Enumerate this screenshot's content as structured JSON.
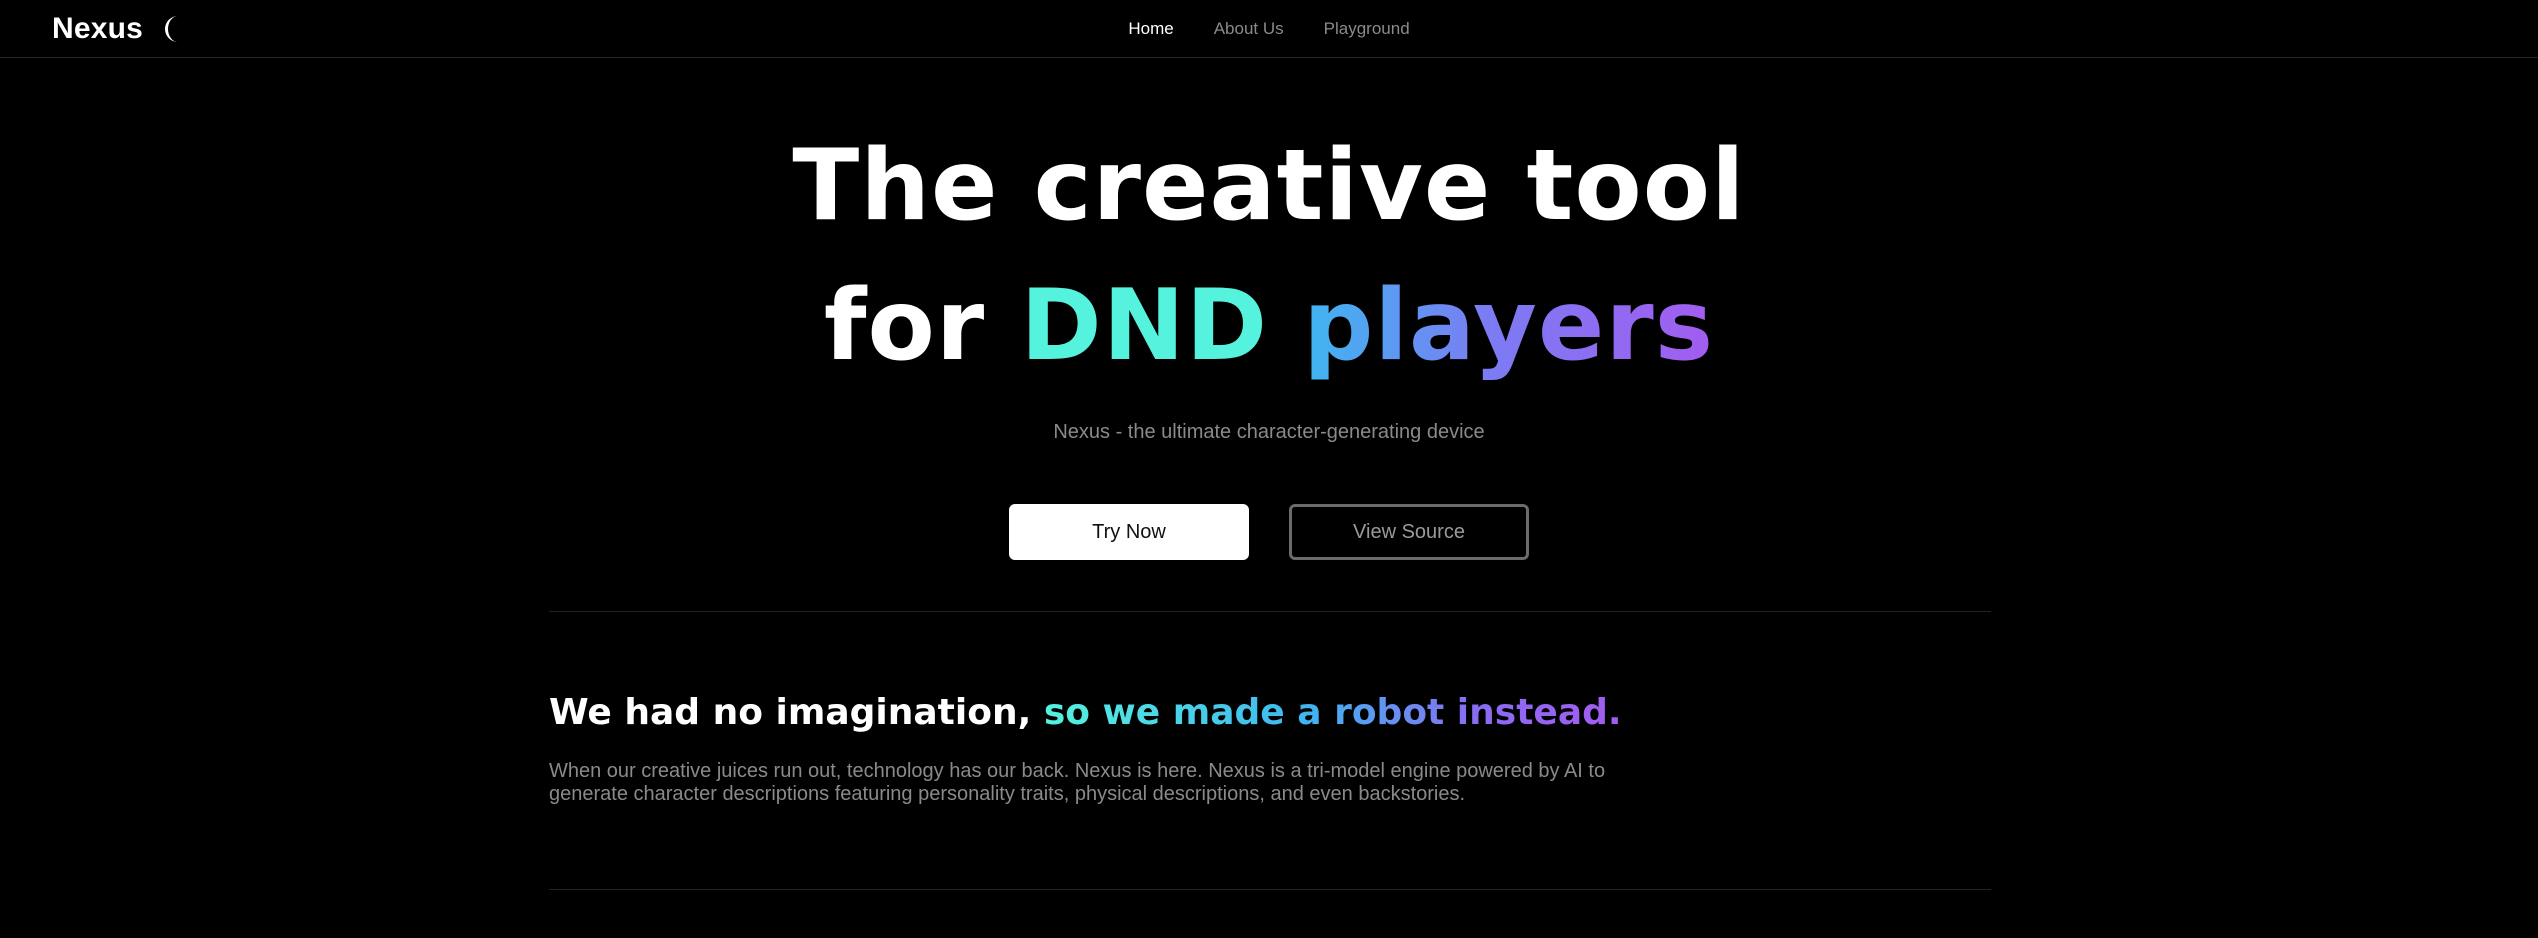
{
  "header": {
    "brand": "Nexus",
    "theme_toggle_icon": "moon-icon",
    "nav": [
      {
        "label": "Home",
        "active": true
      },
      {
        "label": "About Us",
        "active": false
      },
      {
        "label": "Playground",
        "active": false
      }
    ]
  },
  "hero": {
    "title_line1": "The creative tool",
    "title_line2_prefix": "for",
    "title_line2_highlight1": "DND",
    "title_line2_highlight2": "players",
    "subtitle": "Nexus - the ultimate character-generating device",
    "primary_button": "Try Now",
    "secondary_button": "View Source"
  },
  "about": {
    "heading_plain": "We had no imagination,",
    "heading_highlight": "so we made a robot instead.",
    "body": "When our creative juices run out, technology has our back. Nexus is here. Nexus is a tri-model engine powered by AI to generate character descriptions featuring personality traits, physical descriptions, and even backstories."
  },
  "colors": {
    "background": "#000000",
    "text_primary": "#ffffff",
    "text_muted": "#8a8a8a",
    "accent_teal": "#55f2de",
    "accent_blue": "#3fb6f0",
    "accent_purple": "#a35cf0"
  }
}
